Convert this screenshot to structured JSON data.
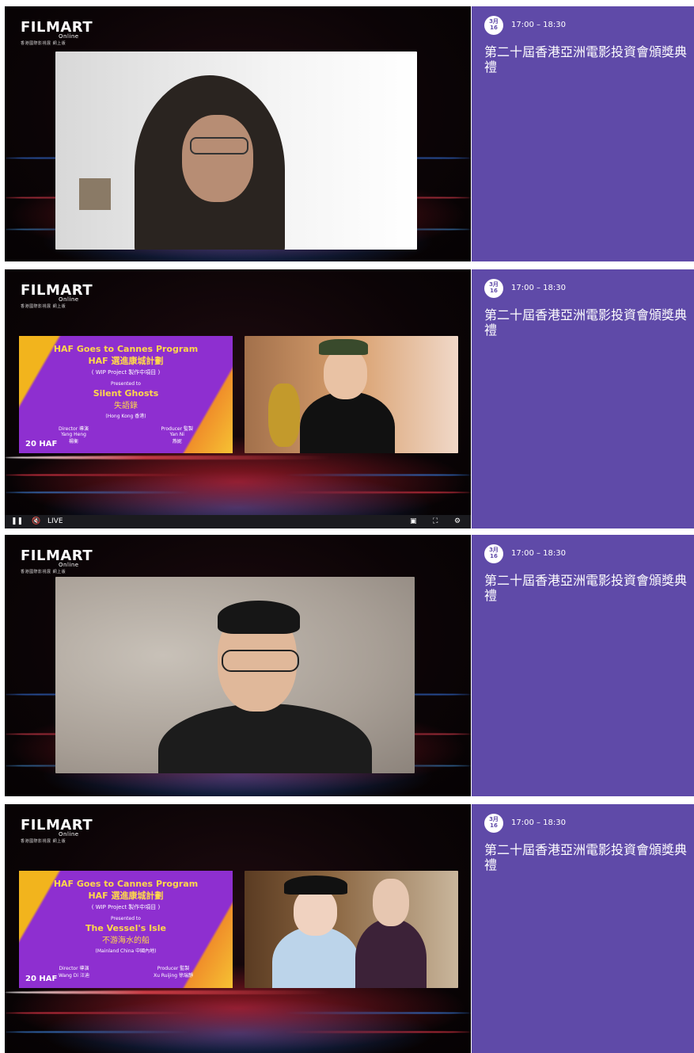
{
  "logo": {
    "brand": "FILMART",
    "sub": "Online",
    "tagline": "香港國際影視展 網上版"
  },
  "schedule": {
    "date_month": "3月",
    "date_day": "16",
    "time": "17:00 – 18:30",
    "title": "第二十屆香港亞洲電影投資會頒獎典禮"
  },
  "haf_cards": [
    {
      "line1": "HAF Goes to Cannes Program",
      "line2": "HAF 選進康城計劃",
      "line3": "( WIP Project 製作中項目 )",
      "presented": "Presented to",
      "film": "Silent Ghosts",
      "film_zh": "失語錄",
      "region": "(Hong Kong 香港)",
      "director_label": "Director 導演",
      "director": "Yang Heng",
      "director_zh": "楊衡",
      "producer_label": "Producer 監製",
      "producer": "Yan Ni",
      "producer_zh": "燕妮"
    },
    {
      "line1": "HAF Goes to Cannes Program",
      "line2": "HAF 選進康城計劃",
      "line3": "( WIP Project 製作中項目 )",
      "presented": "Presented to",
      "film": "The Vessel's Isle",
      "film_zh": "不游海水的船",
      "region": "(Mainland China 中國內地)",
      "director_label": "Director 導演",
      "director": "Wang Di 汪迪",
      "director_zh": "",
      "producer_label": "Producer 監製",
      "producer": "Xu Ruijing 徐瑞靜",
      "producer_zh": ""
    }
  ],
  "haf_logo": "20 HAF",
  "player": {
    "live_label": "LIVE",
    "pause_icon": "pause-icon",
    "mute_icon": "mute-icon",
    "pip_icon": "pip-icon",
    "fullscreen_icon": "fullscreen-icon",
    "settings_icon": "gear-icon"
  }
}
